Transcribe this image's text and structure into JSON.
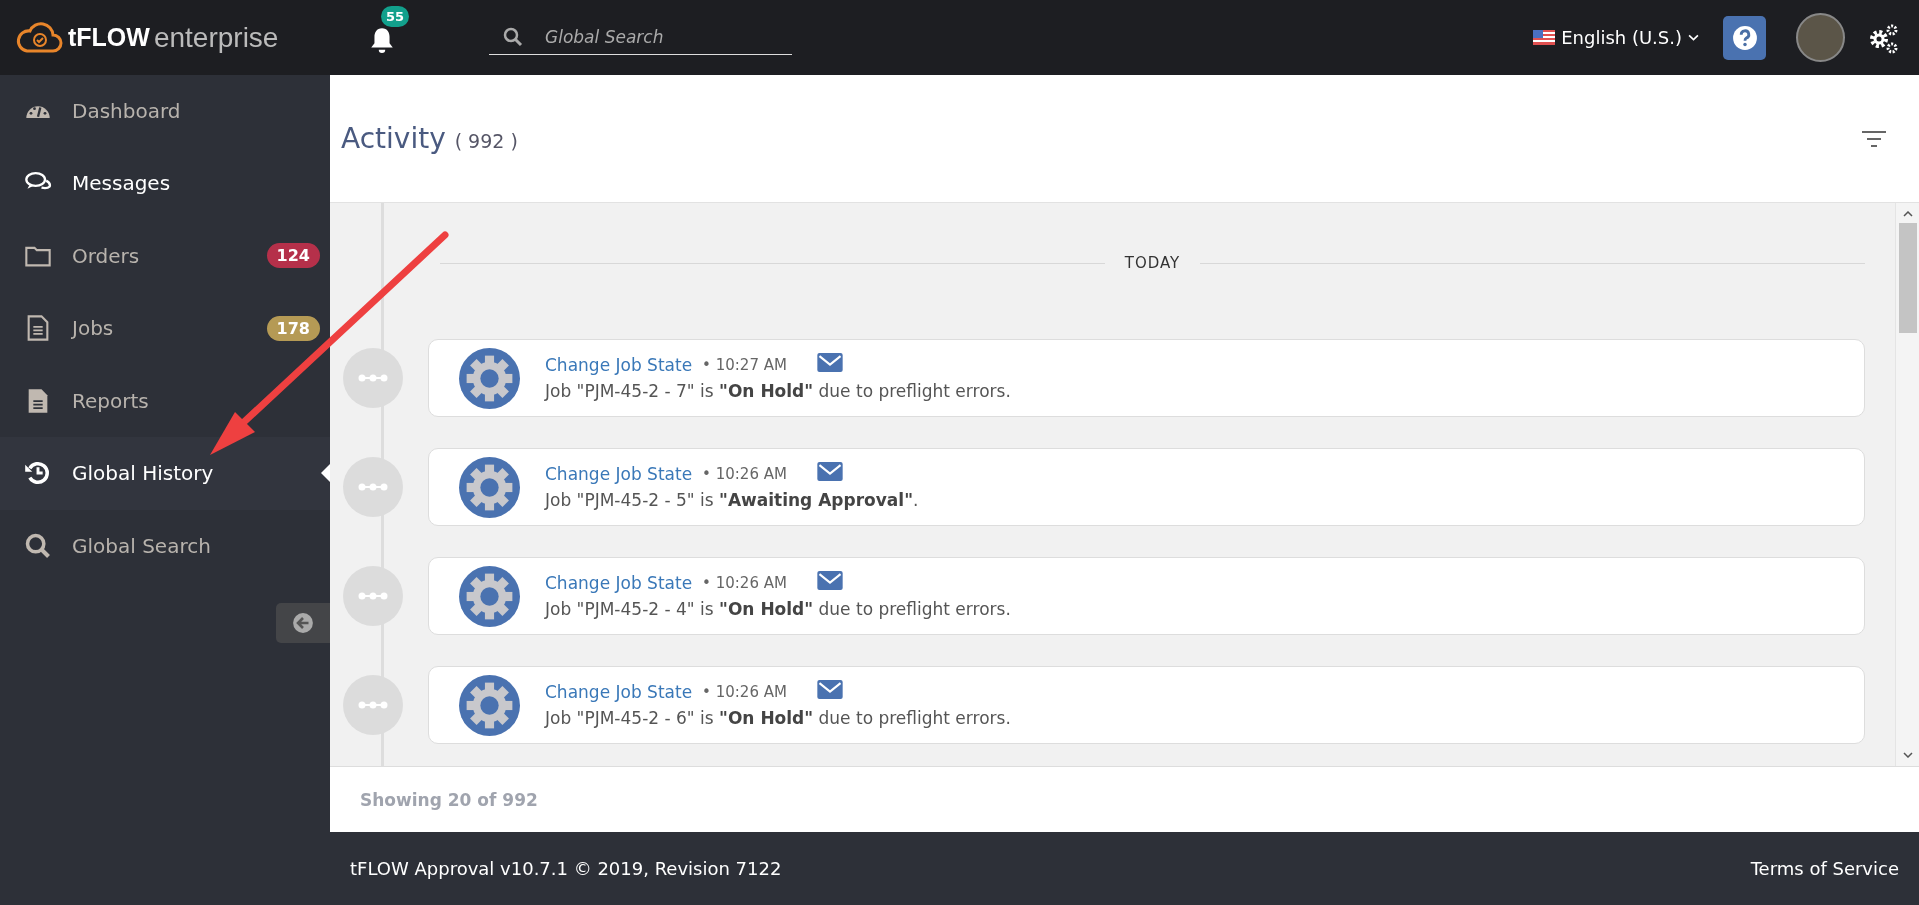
{
  "topbar": {
    "logo_bold": "tFLOW",
    "logo_light": "enterprise",
    "notifications_count": "55",
    "search": {
      "placeholder": "Global Search"
    },
    "language": "English (U.S.)"
  },
  "sidebar": {
    "items": [
      {
        "label": "Dashboard",
        "selected": false,
        "highlighted": false
      },
      {
        "label": "Messages",
        "selected": false,
        "highlighted": true
      },
      {
        "label": "Orders",
        "selected": false,
        "highlighted": false,
        "badge": "124",
        "color": "#b5304a"
      },
      {
        "label": "Jobs",
        "selected": false,
        "highlighted": false,
        "badge": "178",
        "color": "#b59a55"
      },
      {
        "label": "Reports",
        "selected": false,
        "highlighted": false
      },
      {
        "label": "Global History",
        "selected": true,
        "highlighted": false
      },
      {
        "label": "Global Search",
        "selected": false,
        "highlighted": false
      }
    ]
  },
  "activity": {
    "title": "Activity",
    "count": "( 992 )",
    "day_label": "TODAY",
    "entries": [
      {
        "title": "Change Job State",
        "time": "• 10:27 AM",
        "message": "Job \"PJM-45-2 - 7\" is **\"On Hold\"** due to preflight errors."
      },
      {
        "title": "Change Job State",
        "time": "• 10:26 AM",
        "message": "Job \"PJM-45-2 - 5\" is **\"Awaiting Approval\"**."
      },
      {
        "title": "Change Job State",
        "time": "• 10:26 AM",
        "message": "Job \"PJM-45-2 - 4\" is **\"On Hold\"** due to preflight errors."
      },
      {
        "title": "Change Job State",
        "time": "• 10:26 AM",
        "message": "Job \"PJM-45-2 - 6\" is **\"On Hold\"** due to preflight errors."
      }
    ],
    "showing": "Showing 20 of 992"
  },
  "footer": {
    "version": "tFLOW Approval v10.7.1 © 2019, Revision 7122",
    "terms": "Terms of Service"
  }
}
